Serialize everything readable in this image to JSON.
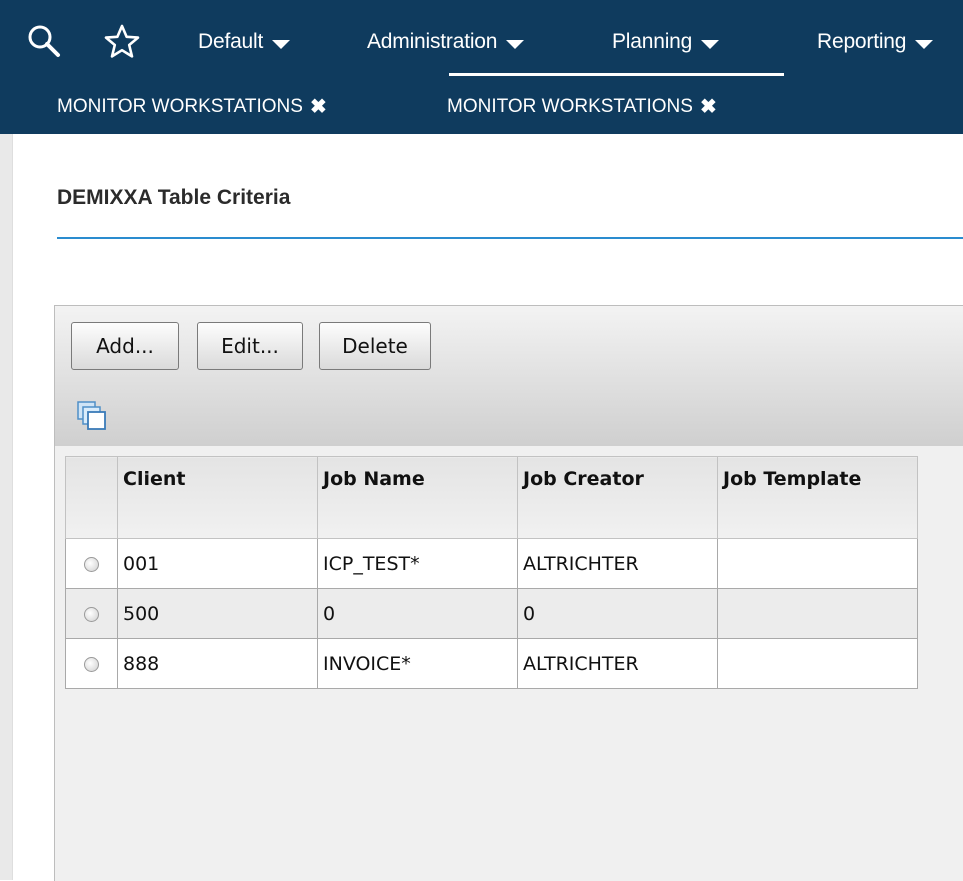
{
  "nav": {
    "menus": [
      "Default",
      "Administration",
      "Planning",
      "Reporting"
    ],
    "tabs": [
      "MONITOR WORKSTATIONS",
      "MONITOR WORKSTATIONS"
    ],
    "tab_close_glyph": "✖"
  },
  "page": {
    "title": "DEMIXXA Table Criteria"
  },
  "toolbar": {
    "add_label": "Add...",
    "edit_label": "Edit...",
    "delete_label": "Delete"
  },
  "table": {
    "columns": [
      "Client",
      "Job Name",
      "Job Creator",
      "Job Template"
    ],
    "rows": [
      {
        "client": "001",
        "job_name": "ICP_TEST*",
        "job_creator": "ALTRICHTER",
        "job_template": ""
      },
      {
        "client": "500",
        "job_name": "0",
        "job_creator": "0",
        "job_template": ""
      },
      {
        "client": "888",
        "job_name": "INVOICE*",
        "job_creator": "ALTRICHTER",
        "job_template": ""
      }
    ]
  },
  "colors": {
    "header_bg": "#0f3b5e",
    "accent_rule": "#2a8ccf"
  },
  "icons": [
    "search-icon",
    "star-icon",
    "chevron-down-icon",
    "close-icon",
    "copy-icon",
    "radio-icon"
  ]
}
